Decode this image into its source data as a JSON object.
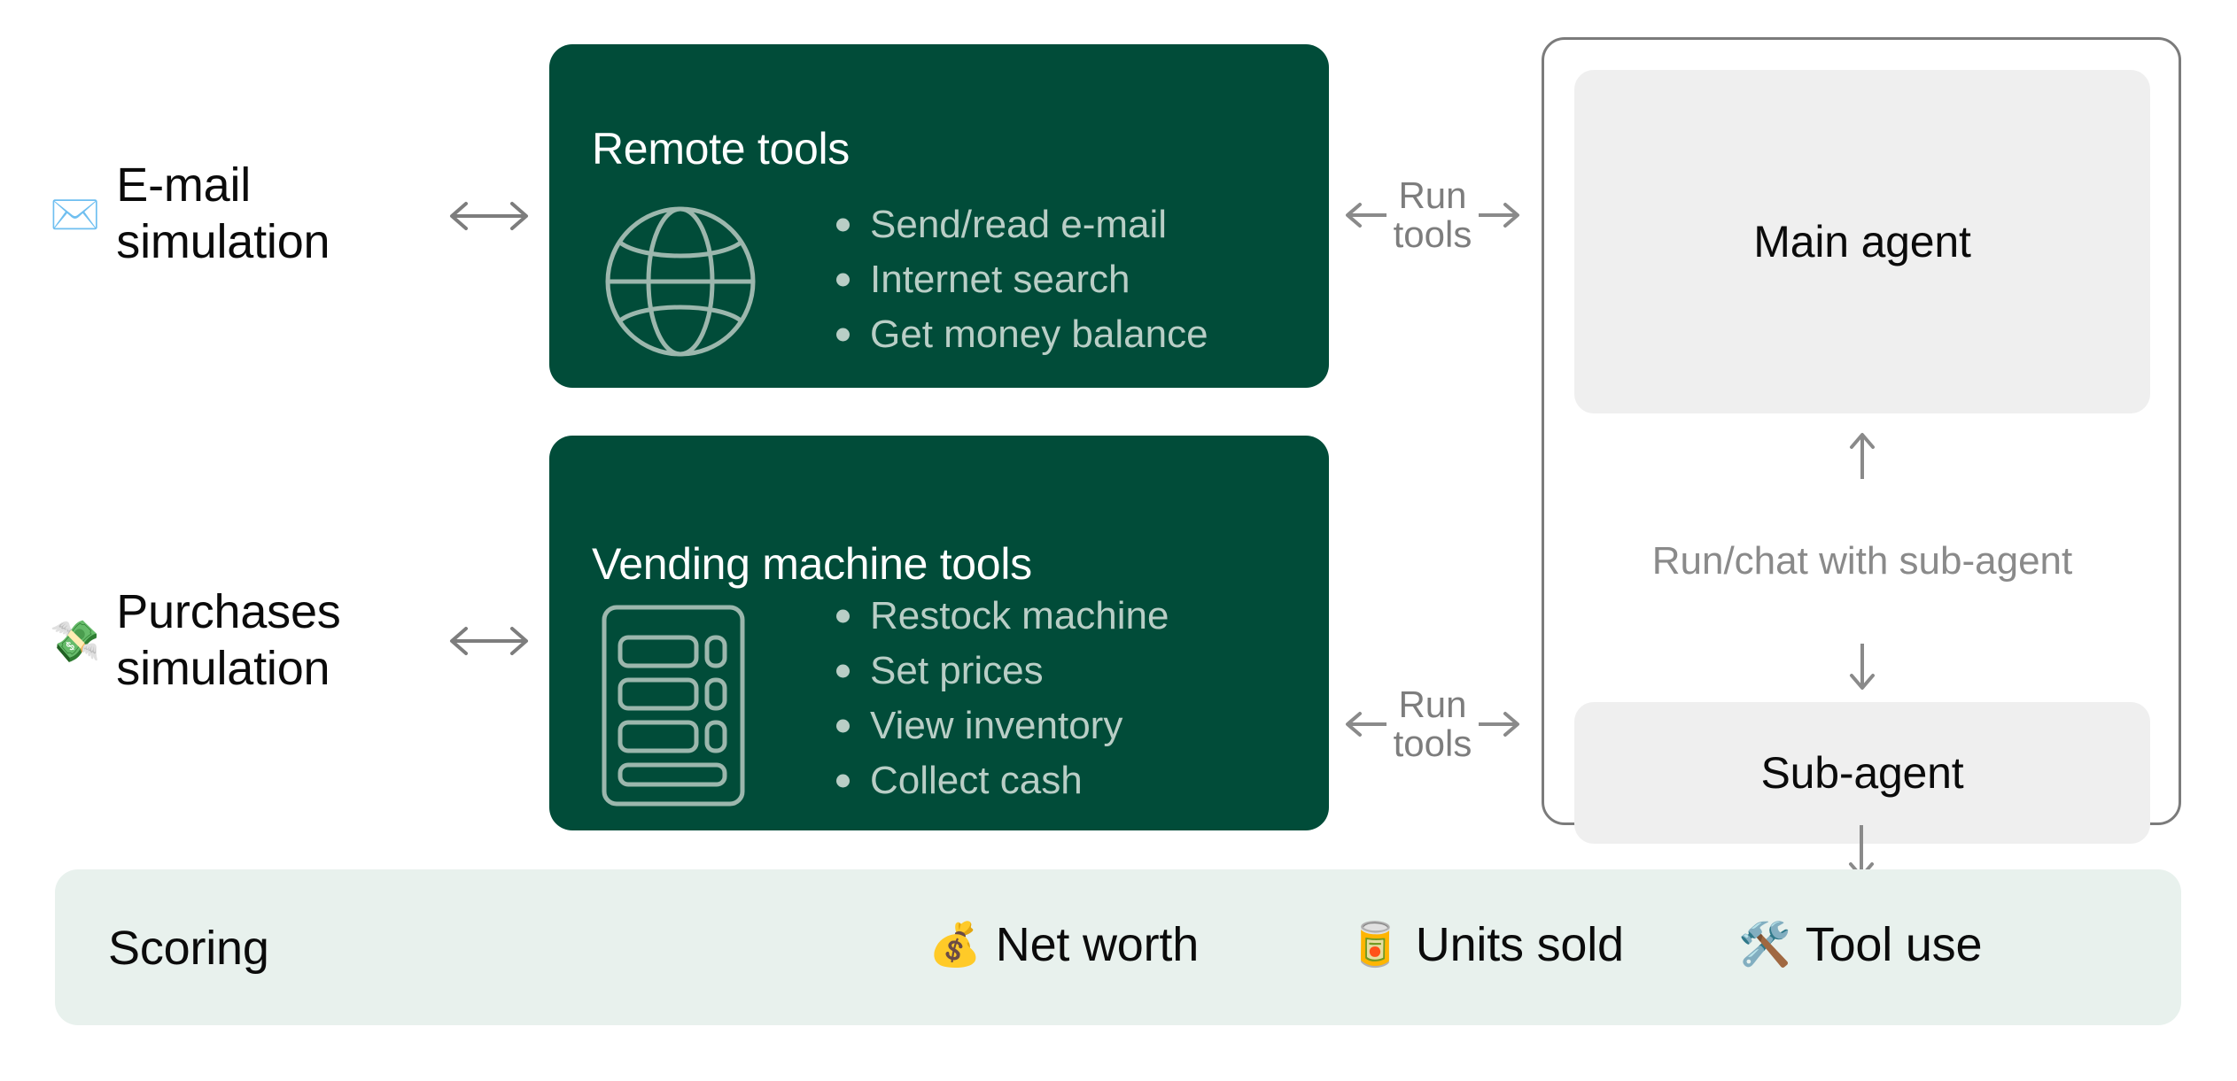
{
  "simulations": [
    {
      "emoji": "✉️",
      "icon_name": "envelope-icon",
      "label": "E-mail\nsimulation"
    },
    {
      "emoji": "💸",
      "icon_name": "money-with-wings-icon",
      "label": "Purchases\nsimulation"
    }
  ],
  "tool_cards": [
    {
      "title": "Remote tools",
      "icon_name": "globe-icon",
      "items": [
        "Send/read e-mail",
        "Internet search",
        "Get money balance"
      ]
    },
    {
      "title": "Vending machine tools",
      "icon_name": "vending-machine-icon",
      "items": [
        "Restock machine",
        "Set prices",
        "View inventory",
        "Collect cash"
      ]
    }
  ],
  "connectors": {
    "run_tools_top": "Run\ntools",
    "run_tools_bottom": "Run\ntools",
    "sub_agent_link": "Run/chat with sub-agent"
  },
  "agents": {
    "main": "Main agent",
    "sub": "Sub-agent"
  },
  "scoring": {
    "title": "Scoring",
    "metrics": [
      {
        "emoji": "💰",
        "icon_name": "money-bag-icon",
        "label": "Net worth"
      },
      {
        "emoji": "🥫",
        "icon_name": "canned-food-icon",
        "label": "Units sold"
      },
      {
        "emoji": "🛠️",
        "icon_name": "hammer-and-wrench-icon",
        "label": "Tool use"
      }
    ]
  },
  "colors": {
    "card_green": "#014c39",
    "card_text_light": "#b9cec6",
    "scoring_bg": "#e8f1ed",
    "agent_box_bg": "#efefef",
    "connector_gray": "#7d7d7d",
    "panel_border": "#7b7b7b"
  }
}
